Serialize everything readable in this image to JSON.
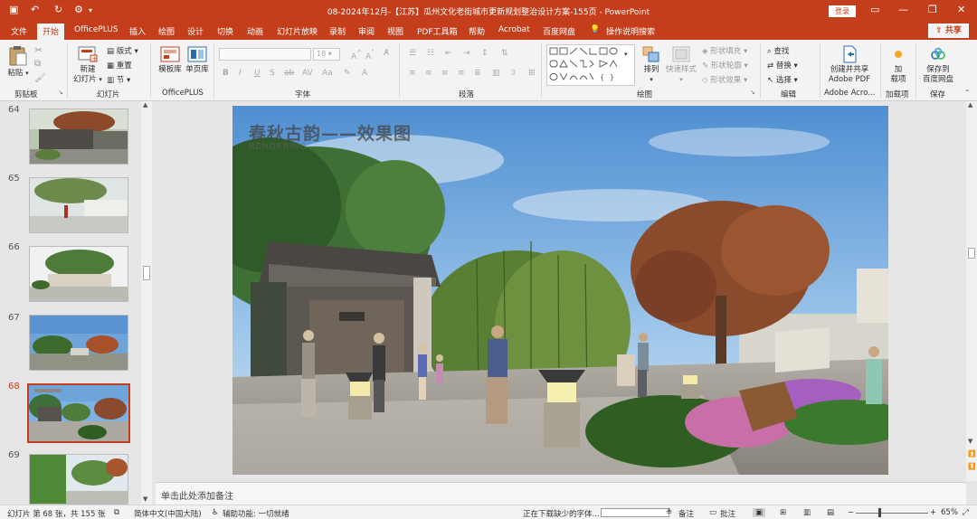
{
  "titlebar": {
    "doc_title": "08-2024年12月-【江苏】瓜州文化老街城市更新规划整治设计方案-155页 - PowerPoint",
    "login": "登录"
  },
  "tabs": [
    "文件",
    "开始",
    "OfficePLUS",
    "插入",
    "绘图",
    "设计",
    "切换",
    "动画",
    "幻灯片放映",
    "录制",
    "审阅",
    "视图",
    "PDF工具箱",
    "帮助",
    "Acrobat",
    "百度网盘",
    "操作说明搜索"
  ],
  "share": "共享",
  "ribbon": {
    "clipboard": {
      "paste": "粘贴",
      "label": "剪贴板"
    },
    "slides": {
      "new_slide_l1": "新建",
      "new_slide_l2": "幻灯片",
      "layout": "版式",
      "reset": "重置",
      "section": "节",
      "label": "幻灯片"
    },
    "officeplus": {
      "template": "模板库",
      "single_page": "单页库",
      "label": "OfficePLUS"
    },
    "font": {
      "size": "18",
      "label": "字体"
    },
    "paragraph": {
      "label": "段落"
    },
    "drawing": {
      "arrange": "排列",
      "quick_styles": "快速样式",
      "shape_fill": "形状填充",
      "shape_outline": "形状轮廓",
      "shape_effects": "形状效果",
      "label": "绘图"
    },
    "editing": {
      "find": "查找",
      "replace": "替换",
      "select": "选择",
      "label": "编辑"
    },
    "adobe": {
      "create_l1": "创建并共享",
      "create_l2": "Adobe PDF",
      "label": "Adobe Acro..."
    },
    "addins": {
      "add_l1": "加",
      "add_l2": "载项",
      "label": "加载项"
    },
    "save": {
      "save_l1": "保存到",
      "save_l2": "百度网盘",
      "label": "保存"
    }
  },
  "slides": [
    {
      "num": "64"
    },
    {
      "num": "65"
    },
    {
      "num": "66"
    },
    {
      "num": "67"
    },
    {
      "num": "68",
      "selected": true
    },
    {
      "num": "69"
    }
  ],
  "slide": {
    "title": "春秋古韵——效果图",
    "subtitle": "RENDERING"
  },
  "notes_placeholder": "单击此处添加备注",
  "status": {
    "slide_pos": "幻灯片 第 68 张，共 155 张",
    "language": "简体中文(中国大陆)",
    "accessibility": "辅助功能: 一切就绪",
    "downloading": "正在下载缺少的字体...",
    "notes": "备注",
    "comments": "批注",
    "zoom": "65%"
  },
  "colors": {
    "accent": "#c43e1c"
  }
}
